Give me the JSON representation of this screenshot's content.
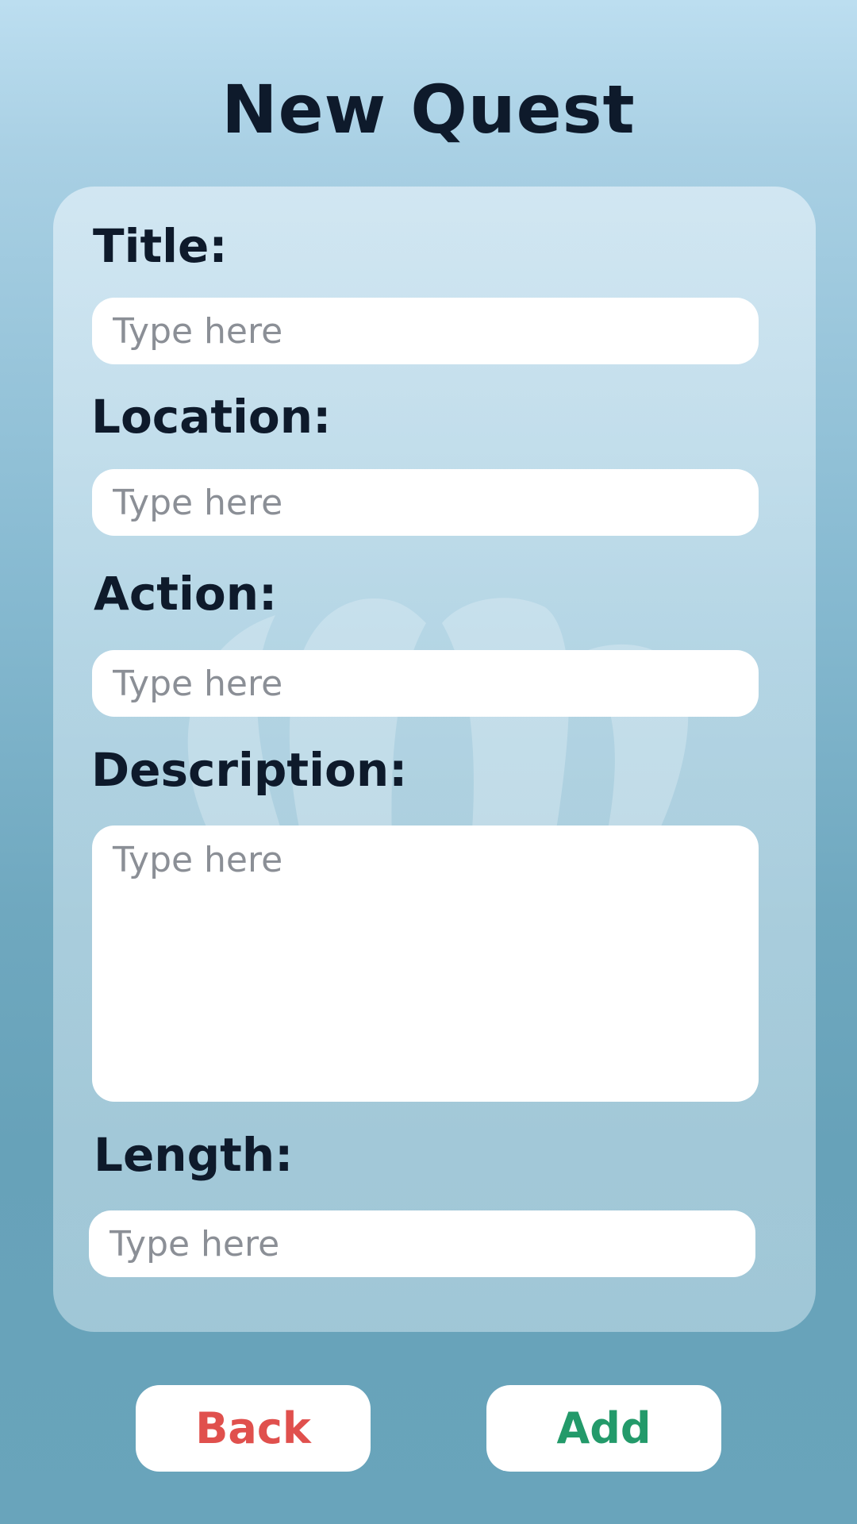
{
  "header": {
    "title": "New Quest"
  },
  "form": {
    "fields": [
      {
        "label": "Title:",
        "placeholder": "Type here"
      },
      {
        "label": "Location:",
        "placeholder": "Type here"
      },
      {
        "label": "Action:",
        "placeholder": "Type here"
      },
      {
        "label": "Description:",
        "placeholder": "Type here"
      },
      {
        "label": "Length:",
        "placeholder": "Type here"
      }
    ]
  },
  "actions": {
    "back_label": "Back",
    "add_label": "Add"
  },
  "colors": {
    "title_text": "#0e1a2b",
    "back_text": "#e0504d",
    "add_text": "#239a6a",
    "background_top": "#bcdef0",
    "background_bottom": "#69a4bb"
  }
}
